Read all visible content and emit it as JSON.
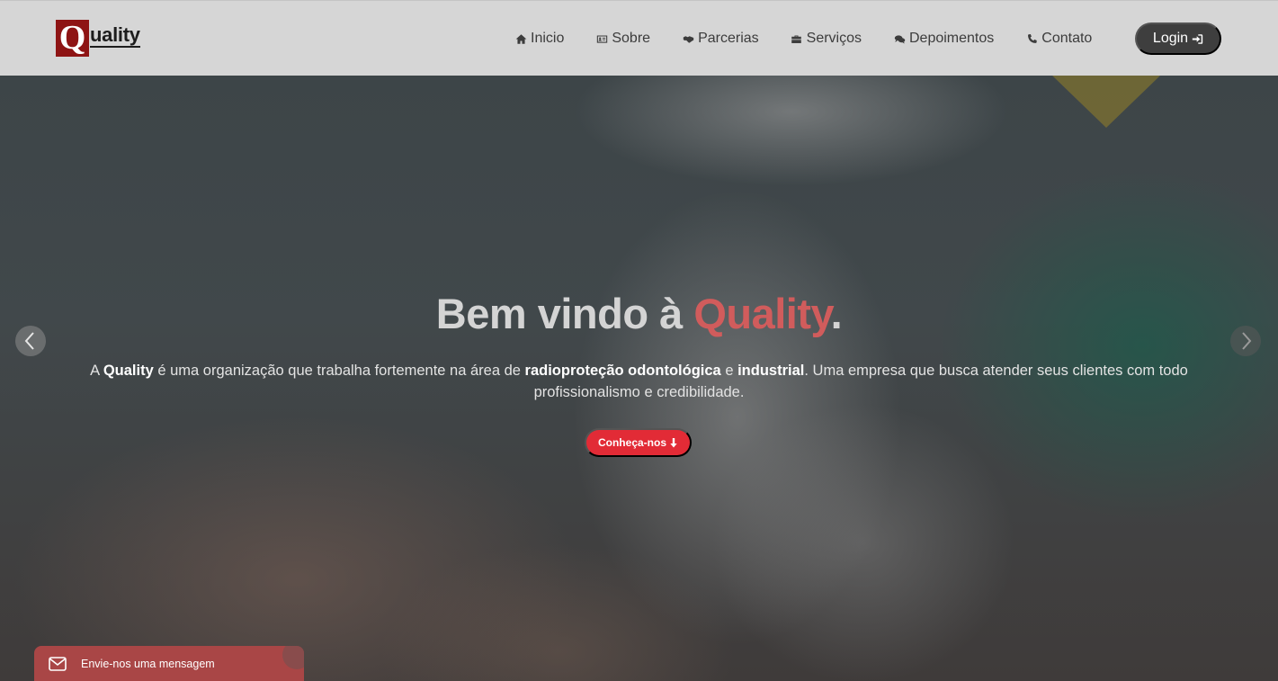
{
  "logo": {
    "initial": "Q",
    "rest": "uality"
  },
  "nav": {
    "items": [
      {
        "label": "Inicio",
        "icon": "home-icon"
      },
      {
        "label": "Sobre",
        "icon": "id-card-icon"
      },
      {
        "label": "Parcerias",
        "icon": "handshake-icon"
      },
      {
        "label": "Serviços",
        "icon": "toolbox-icon"
      },
      {
        "label": "Depoimentos",
        "icon": "comments-icon"
      },
      {
        "label": "Contato",
        "icon": "phone-icon"
      }
    ],
    "login_label": "Login"
  },
  "hero": {
    "title_prefix": "Bem vindo à ",
    "title_brand": "Quality",
    "title_suffix": ".",
    "desc": {
      "p1": "A ",
      "b1": "Quality",
      "p2": " é uma organização que trabalha fortemente na área de ",
      "b2": "radioproteção odontológica",
      "p3": " e ",
      "b3": "industrial",
      "p4": ". Uma empresa que busca atender seus clientes com todo profissionalismo e credibilidade."
    },
    "cta_label": "Conheça-nos"
  },
  "chat": {
    "label": "Envie-nos uma mensagem"
  },
  "colors": {
    "navbar_bg": "#d6d6d6",
    "brand_red": "#d15c5c",
    "cta_red": "#e22b36",
    "logo_red": "#8e1414",
    "login_bg": "#3e3e3e",
    "chat_bg": "#a94646"
  }
}
